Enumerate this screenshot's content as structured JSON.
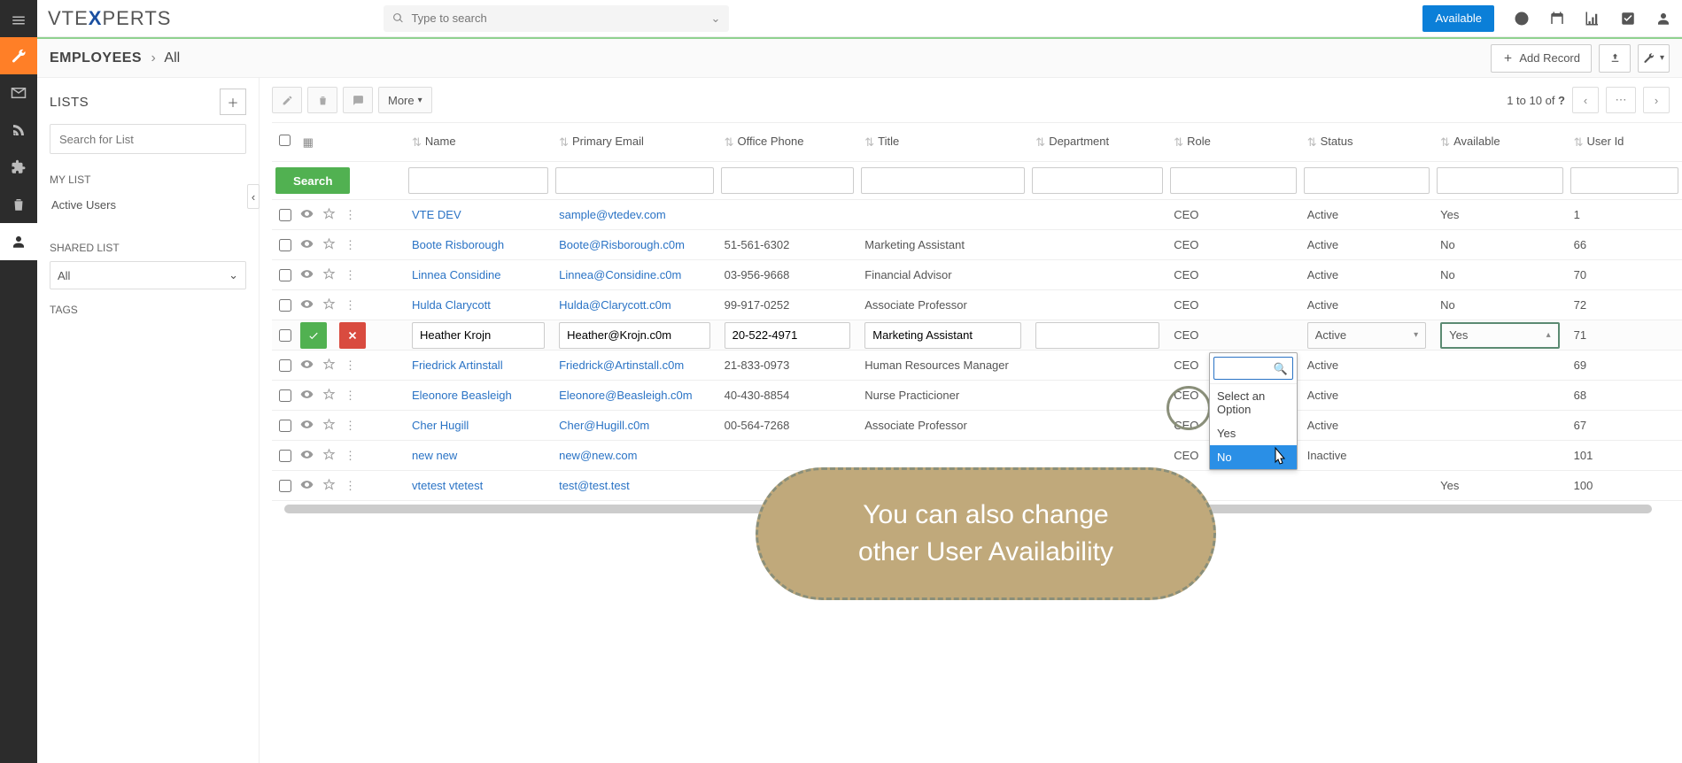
{
  "header": {
    "logo_prefix": "VTE",
    "logo_mid": "X",
    "logo_suffix": "PERTS",
    "search_placeholder": "Type to search",
    "available_button": "Available"
  },
  "subheader": {
    "module": "EMPLOYEES",
    "crumb": "All",
    "add_record": "Add Record"
  },
  "lists_panel": {
    "title": "LISTS",
    "search_placeholder": "Search for List",
    "my_list_label": "MY LIST",
    "my_list_items": [
      "Active Users"
    ],
    "shared_label": "SHARED LIST",
    "shared_value": "All",
    "tags_label": "TAGS"
  },
  "toolbar": {
    "more_label": "More",
    "pager_text_prefix": "1 to 10  of ",
    "pager_total": "?"
  },
  "table": {
    "search_button": "Search",
    "columns": [
      "Name",
      "Primary Email",
      "Office Phone",
      "Title",
      "Department",
      "Role",
      "Status",
      "Available",
      "User Id"
    ],
    "rows": [
      {
        "name": "VTE DEV",
        "email": "sample@vtedev.com",
        "phone": "",
        "title": "",
        "dept": "",
        "role": "CEO",
        "status": "Active",
        "avail": "Yes",
        "uid": "1"
      },
      {
        "name": "Boote Risborough",
        "email": "Boote@Risborough.c0m",
        "phone": "51-561-6302",
        "title": "Marketing Assistant",
        "dept": "",
        "role": "CEO",
        "status": "Active",
        "avail": "No",
        "uid": "66"
      },
      {
        "name": "Linnea Considine",
        "email": "Linnea@Considine.c0m",
        "phone": "03-956-9668",
        "title": "Financial Advisor",
        "dept": "",
        "role": "CEO",
        "status": "Active",
        "avail": "No",
        "uid": "70"
      },
      {
        "name": "Hulda Clarycott",
        "email": "Hulda@Clarycott.c0m",
        "phone": "99-917-0252",
        "title": "Associate Professor",
        "dept": "",
        "role": "CEO",
        "status": "Active",
        "avail": "No",
        "uid": "72"
      },
      {
        "name": "Heather Krojn",
        "email": "Heather@Krojn.c0m",
        "phone": "20-522-4971",
        "title": "Marketing Assistant",
        "dept": "",
        "role": "CEO",
        "status": "Active",
        "avail": "Yes",
        "uid": "71",
        "editing": true
      },
      {
        "name": "Friedrick Artinstall",
        "email": "Friedrick@Artinstall.c0m",
        "phone": "21-833-0973",
        "title": "Human Resources Manager",
        "dept": "",
        "role": "CEO",
        "status": "Active",
        "avail": "",
        "uid": "69"
      },
      {
        "name": "Eleonore Beasleigh",
        "email": "Eleonore@Beasleigh.c0m",
        "phone": "40-430-8854",
        "title": "Nurse Practicioner",
        "dept": "",
        "role": "CEO",
        "status": "Active",
        "avail": "",
        "uid": "68"
      },
      {
        "name": "Cher Hugill",
        "email": "Cher@Hugill.c0m",
        "phone": "00-564-7268",
        "title": "Associate Professor",
        "dept": "",
        "role": "CEO",
        "status": "Active",
        "avail": "",
        "uid": "67"
      },
      {
        "name": "new new",
        "email": "new@new.com",
        "phone": "",
        "title": "",
        "dept": "",
        "role": "CEO",
        "status": "Inactive",
        "avail": "",
        "uid": "101"
      },
      {
        "name": "vtetest vtetest",
        "email": "test@test.test",
        "phone": "",
        "title": "",
        "dept": "",
        "role": "",
        "status": "",
        "avail": "Yes",
        "uid": "100"
      }
    ]
  },
  "dropdown": {
    "placeholder": "",
    "options": [
      "Select an Option",
      "Yes",
      "No"
    ],
    "highlighted": "No"
  },
  "callout": {
    "line1": "You can also change",
    "line2": "other User Availability"
  }
}
